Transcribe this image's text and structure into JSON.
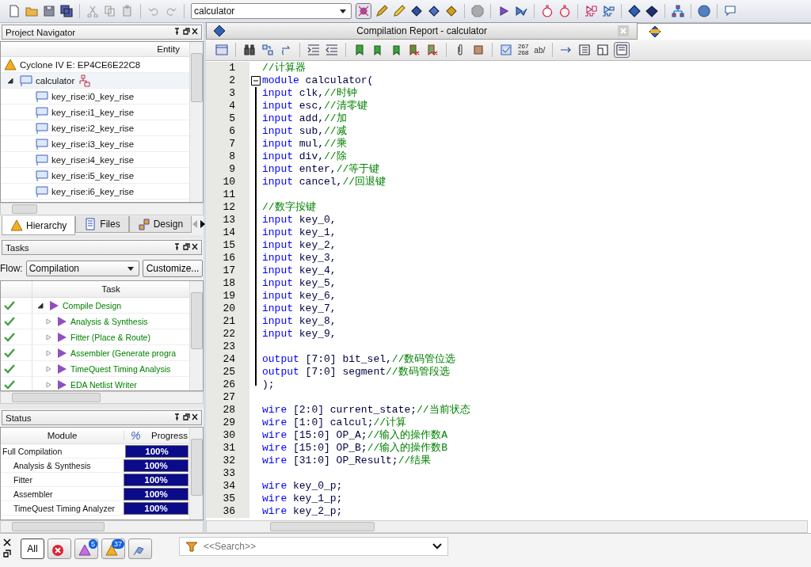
{
  "toolbar": {
    "project_dropdown": "calculator"
  },
  "project_navigator": {
    "title": "Project Navigator",
    "column": "Entity",
    "device": "Cyclone IV E: EP4CE6E22C8",
    "tree": [
      {
        "label": "calculator",
        "expanded": true,
        "selected": true,
        "children": [
          {
            "label": "key_rise:i0_key_rise",
            "selected": false
          },
          {
            "label": "key_rise:i1_key_rise",
            "selected": false
          },
          {
            "label": "key_rise:i2_key_rise",
            "selected": false
          },
          {
            "label": "key_rise:i3_key_rise",
            "selected": false
          },
          {
            "label": "key_rise:i4_key_rise",
            "selected": false
          },
          {
            "label": "key_rise:i5_key_rise",
            "selected": false
          },
          {
            "label": "key_rise:i6_key_rise",
            "selected": false
          }
        ]
      }
    ],
    "tabs": [
      {
        "label": "Hierarchy",
        "kind": "hierarchy",
        "selected": true
      },
      {
        "label": "Files",
        "kind": "files",
        "selected": false
      },
      {
        "label": "Design",
        "kind": "design",
        "selected": false
      }
    ]
  },
  "tasks": {
    "title": "Tasks",
    "flow_label": "Flow:",
    "flow": "Compilation",
    "customize": "Customize...",
    "column": "Task",
    "items": [
      {
        "label": "Compile Design",
        "done": true,
        "expanded": true,
        "children": [
          {
            "label": "Analysis & Synthesis",
            "done": true,
            "expanded": false
          },
          {
            "label": "Fitter (Place & Route)",
            "done": true,
            "expanded": false
          },
          {
            "label": "Assembler (Generate progra",
            "done": true,
            "expanded": false
          },
          {
            "label": "TimeQuest Timing Analysis",
            "done": true,
            "expanded": false
          },
          {
            "label": "EDA Netlist Writer",
            "done": true,
            "expanded": false
          }
        ]
      }
    ]
  },
  "status": {
    "title": "Status",
    "columns": [
      "Module",
      "%",
      "Progress"
    ],
    "rows": [
      {
        "module": "Full Compilation",
        "progress": "100%",
        "level": 1,
        "children": [
          {
            "module": "Analysis & Synthesis",
            "progress": "100%",
            "level": 1
          },
          {
            "module": "Fitter",
            "progress": "100%",
            "level": 1
          },
          {
            "module": "Assembler",
            "progress": "100%",
            "level": 1
          },
          {
            "module": "TimeQuest Timing Analyzer",
            "progress": "100%",
            "level": 1
          }
        ]
      }
    ]
  },
  "editor": {
    "tabs": [
      {
        "kind": "report",
        "label": "Compilation Report - calculator",
        "selected": false
      },
      {
        "kind": "file",
        "selected": true
      }
    ],
    "toolbar_texts": [
      "267",
      "268",
      "ab/"
    ],
    "lines": [
      {
        "n": "1",
        "fold_box": false,
        "fold_bar": false,
        "comment": "//计算器"
      },
      {
        "n": "2",
        "fold_box": true,
        "fold_bar": false,
        "kw": "module",
        "code": "calculator("
      },
      {
        "n": "3",
        "fold_box": false,
        "fold_bar": true,
        "kw": "input",
        "code": "clk,",
        "comment": "//时钟"
      },
      {
        "n": "4",
        "fold_box": false,
        "fold_bar": true,
        "kw": "input",
        "code": "esc,",
        "comment": "//清零键"
      },
      {
        "n": "5",
        "fold_box": false,
        "fold_bar": true,
        "kw": "input",
        "code": "add,",
        "comment": "//加"
      },
      {
        "n": "6",
        "fold_box": false,
        "fold_bar": true,
        "kw": "input",
        "code": "sub,",
        "comment": "//减"
      },
      {
        "n": "7",
        "fold_box": false,
        "fold_bar": true,
        "kw": "input",
        "code": "mul,",
        "comment": "//乘"
      },
      {
        "n": "8",
        "fold_box": false,
        "fold_bar": true,
        "kw": "input",
        "code": "div,",
        "comment": "//除"
      },
      {
        "n": "9",
        "fold_box": false,
        "fold_bar": true,
        "kw": "input",
        "code": "enter,",
        "comment": "//等于键"
      },
      {
        "n": "10",
        "fold_box": false,
        "fold_bar": true,
        "kw": "input",
        "code": "cancel,",
        "comment": "//回退键"
      },
      {
        "n": "11",
        "fold_box": false,
        "fold_bar": true
      },
      {
        "n": "12",
        "fold_box": false,
        "fold_bar": true,
        "comment": "//数字按键"
      },
      {
        "n": "13",
        "fold_box": false,
        "fold_bar": true,
        "kw": "input",
        "code": "key_0,"
      },
      {
        "n": "14",
        "fold_box": false,
        "fold_bar": true,
        "kw": "input",
        "code": "key_1,"
      },
      {
        "n": "15",
        "fold_box": false,
        "fold_bar": true,
        "kw": "input",
        "code": "key_2,"
      },
      {
        "n": "16",
        "fold_box": false,
        "fold_bar": true,
        "kw": "input",
        "code": "key_3,"
      },
      {
        "n": "17",
        "fold_box": false,
        "fold_bar": true,
        "kw": "input",
        "code": "key_4,"
      },
      {
        "n": "18",
        "fold_box": false,
        "fold_bar": true,
        "kw": "input",
        "code": "key_5,"
      },
      {
        "n": "19",
        "fold_box": false,
        "fold_bar": true,
        "kw": "input",
        "code": "key_6,"
      },
      {
        "n": "20",
        "fold_box": false,
        "fold_bar": true,
        "kw": "input",
        "code": "key_7,"
      },
      {
        "n": "21",
        "fold_box": false,
        "fold_bar": true,
        "kw": "input",
        "code": "key_8,"
      },
      {
        "n": "22",
        "fold_box": false,
        "fold_bar": true,
        "kw": "input",
        "code": "key_9,"
      },
      {
        "n": "23",
        "fold_box": false,
        "fold_bar": true
      },
      {
        "n": "24",
        "fold_box": false,
        "fold_bar": true,
        "kw": "output",
        "code": "[7:0] bit_sel,",
        "comment": "//数码管位选"
      },
      {
        "n": "25",
        "fold_box": false,
        "fold_bar": true,
        "kw": "output",
        "code": "[7:0] segment",
        "comment": "//数码管段选"
      },
      {
        "n": "26",
        "fold_box": false,
        "fold_bar": true,
        "code": ");"
      },
      {
        "n": "27",
        "fold_box": false,
        "fold_bar": false
      },
      {
        "n": "28",
        "fold_box": false,
        "fold_bar": false,
        "kw": "wire",
        "code": "[2:0] current_state;",
        "comment": "//当前状态"
      },
      {
        "n": "29",
        "fold_box": false,
        "fold_bar": false,
        "kw": "wire",
        "code": "[1:0] calcul;",
        "comment": "//计算"
      },
      {
        "n": "30",
        "fold_box": false,
        "fold_bar": false,
        "kw": "wire",
        "code": "[15:0] OP_A;",
        "comment": "//输入的操作数A"
      },
      {
        "n": "31",
        "fold_box": false,
        "fold_bar": false,
        "kw": "wire",
        "code": "[15:0] OP_B;",
        "comment": "//输入的操作数B"
      },
      {
        "n": "32",
        "fold_box": false,
        "fold_bar": false,
        "kw": "wire",
        "code": "[31:0] OP_Result;",
        "comment": "//结果"
      },
      {
        "n": "33",
        "fold_box": false,
        "fold_bar": false
      },
      {
        "n": "34",
        "fold_box": false,
        "fold_bar": false,
        "kw": "wire",
        "code": "key_0_p;"
      },
      {
        "n": "35",
        "fold_box": false,
        "fold_bar": false,
        "kw": "wire",
        "code": "key_1_p;"
      },
      {
        "n": "36",
        "fold_box": false,
        "fold_bar": false,
        "kw": "wire",
        "code": "key_2_p;"
      }
    ]
  },
  "messages": {
    "filters": [
      {
        "kind": "all",
        "label": "All",
        "selected": true
      },
      {
        "kind": "error",
        "selected": false
      },
      {
        "kind": "critical",
        "count": "5",
        "selected": false
      },
      {
        "kind": "warning",
        "count": "37",
        "selected": false
      },
      {
        "kind": "suppressed",
        "selected": false
      }
    ],
    "search_placeholder": "<<Search>>"
  }
}
